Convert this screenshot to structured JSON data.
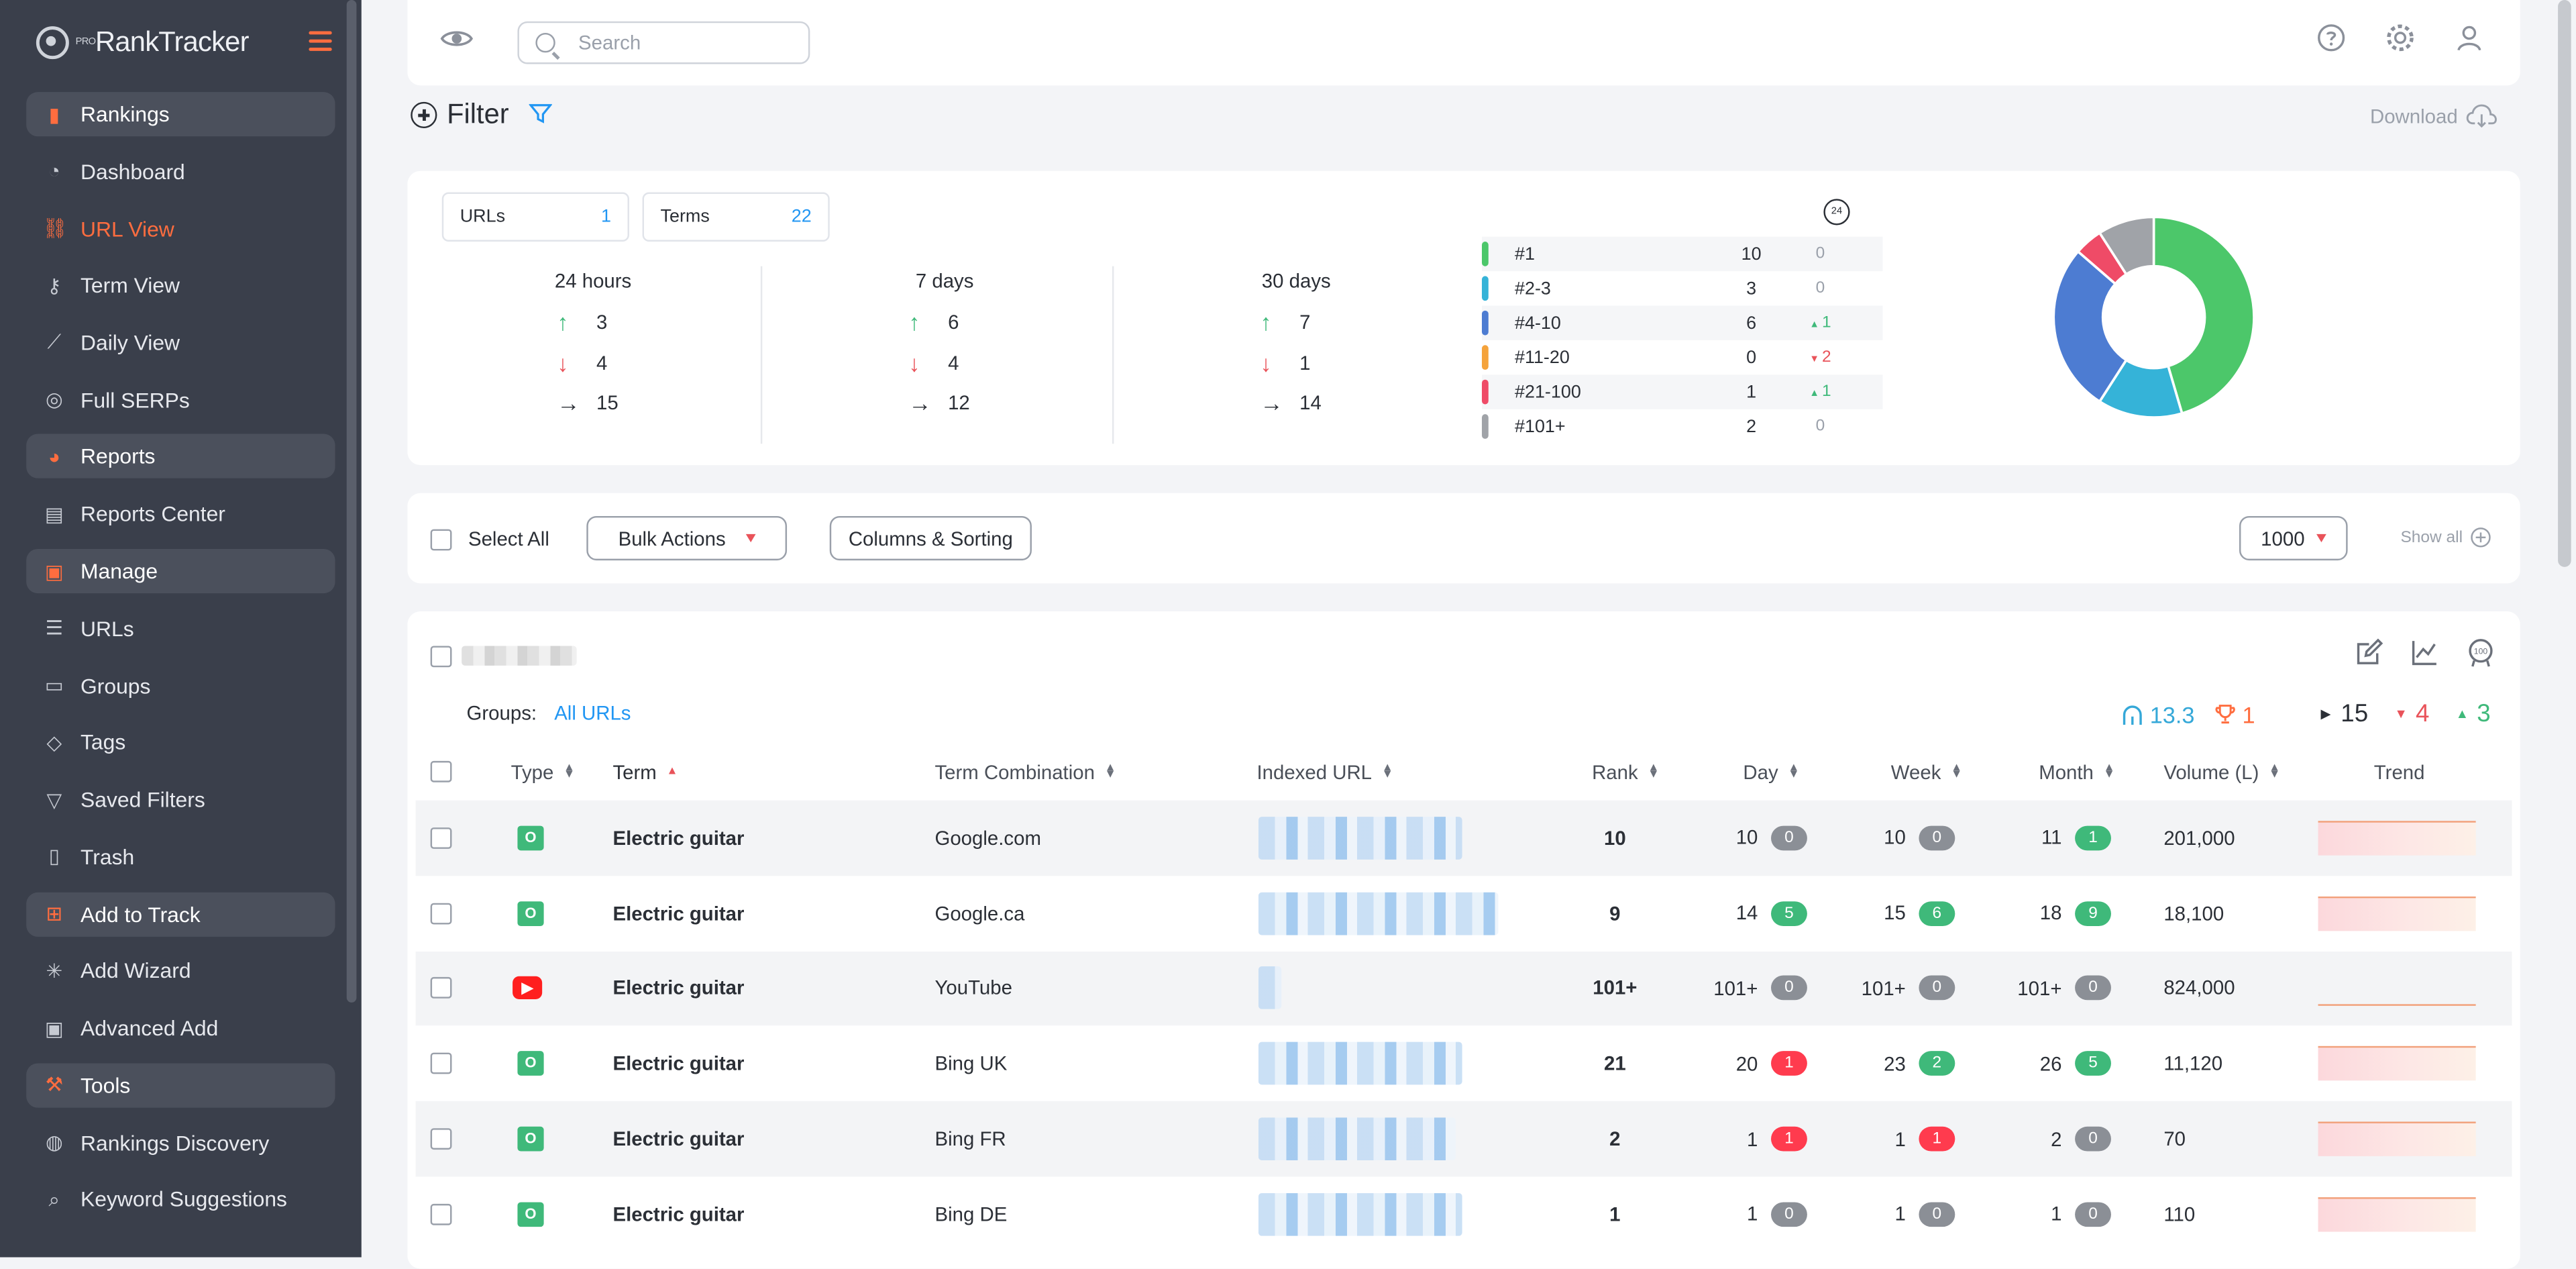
{
  "app": {
    "logo_text": "RankTracker",
    "logo_prefix": "PRO"
  },
  "sidebar": {
    "items": [
      {
        "label": "Rankings",
        "type": "section",
        "icon": "rankings-icon"
      },
      {
        "label": "Dashboard",
        "type": "item",
        "icon": "dashboard-icon"
      },
      {
        "label": "URL View",
        "type": "item",
        "icon": "link-icon",
        "active": true
      },
      {
        "label": "Term View",
        "type": "item",
        "icon": "key-icon"
      },
      {
        "label": "Daily View",
        "type": "item",
        "icon": "chart-icon"
      },
      {
        "label": "Full SERPs",
        "type": "item",
        "icon": "serp-icon"
      },
      {
        "label": "Reports",
        "type": "section",
        "icon": "pie-icon"
      },
      {
        "label": "Reports Center",
        "type": "item",
        "icon": "document-icon"
      },
      {
        "label": "Manage",
        "type": "section",
        "icon": "manage-icon"
      },
      {
        "label": "URLs",
        "type": "item",
        "icon": "list-icon"
      },
      {
        "label": "Groups",
        "type": "item",
        "icon": "folder-icon"
      },
      {
        "label": "Tags",
        "type": "item",
        "icon": "tag-icon"
      },
      {
        "label": "Saved Filters",
        "type": "item",
        "icon": "filter-icon"
      },
      {
        "label": "Trash",
        "type": "item",
        "icon": "trash-icon"
      },
      {
        "label": "Add to Track",
        "type": "section",
        "icon": "plus-square-icon"
      },
      {
        "label": "Add Wizard",
        "type": "item",
        "icon": "wizard-icon"
      },
      {
        "label": "Advanced Add",
        "type": "item",
        "icon": "clipboard-icon"
      },
      {
        "label": "Tools",
        "type": "section",
        "icon": "tools-icon"
      },
      {
        "label": "Rankings Discovery",
        "type": "item",
        "icon": "globe-icon"
      },
      {
        "label": "Keyword Suggestions",
        "type": "item",
        "icon": "search-icon"
      }
    ]
  },
  "topbar": {
    "search_placeholder": "Search"
  },
  "filter": {
    "title": "Filter",
    "download_label": "Download"
  },
  "summary": {
    "urls_label": "URLs",
    "urls_count": "1",
    "terms_label": "Terms",
    "terms_count": "22",
    "periods": [
      {
        "title": "24 hours",
        "up": "3",
        "down": "4",
        "flat": "15"
      },
      {
        "title": "7 days",
        "up": "6",
        "down": "4",
        "flat": "12"
      },
      {
        "title": "30 days",
        "up": "7",
        "down": "1",
        "flat": "14"
      }
    ],
    "clock_label": "24",
    "distribution": [
      {
        "label": "#1",
        "count": "10",
        "change": "0",
        "dir": "none",
        "color": "#4cc76a"
      },
      {
        "label": "#2-3",
        "count": "3",
        "change": "0",
        "dir": "none",
        "color": "#35b3d8"
      },
      {
        "label": "#4-10",
        "count": "6",
        "change": "1",
        "dir": "up",
        "color": "#4d7cd2"
      },
      {
        "label": "#11-20",
        "count": "0",
        "change": "2",
        "dir": "down",
        "color": "#f5a33b"
      },
      {
        "label": "#21-100",
        "count": "1",
        "change": "1",
        "dir": "up",
        "color": "#ef4b67"
      },
      {
        "label": "#101+",
        "count": "2",
        "change": "0",
        "dir": "none",
        "color": "#a0a3a8"
      }
    ],
    "donut_colors": [
      "#4cc76a",
      "#4fb3e6",
      "#4d7cd2",
      "#ef4b67",
      "#a0a3a8"
    ]
  },
  "bulk": {
    "select_all": "Select All",
    "bulk_actions": "Bulk Actions",
    "columns_sorting": "Columns & Sorting",
    "page_size": "1000",
    "show_all": "Show all"
  },
  "table": {
    "groups_label": "Groups:",
    "groups_value": "All URLs",
    "stats": {
      "avg": "13.3",
      "top": "1",
      "flat": "15",
      "down": "4",
      "up": "3"
    },
    "headers": {
      "type": "Type",
      "term": "Term",
      "combo": "Term Combination",
      "url": "Indexed URL",
      "rank": "Rank",
      "day": "Day",
      "week": "Week",
      "month": "Month",
      "volume": "Volume (L)",
      "trend": "Trend"
    },
    "rows": [
      {
        "type": "g",
        "term": "Electric guitar",
        "combo": "Google.com",
        "rank": "10",
        "day": "10",
        "day_chg": "0",
        "day_dir": "z",
        "week": "10",
        "week_chg": "0",
        "week_dir": "z",
        "month": "11",
        "month_chg": "1",
        "month_dir": "p",
        "volume": "201,000",
        "url_w": 124
      },
      {
        "type": "g",
        "term": "Electric guitar",
        "combo": "Google.ca",
        "rank": "9",
        "day": "14",
        "day_chg": "5",
        "day_dir": "p",
        "week": "15",
        "week_chg": "6",
        "week_dir": "p",
        "month": "18",
        "month_chg": "9",
        "month_dir": "p",
        "volume": "18,100",
        "url_w": 146
      },
      {
        "type": "yt",
        "term": "Electric guitar",
        "combo": "YouTube",
        "rank": "101+",
        "day": "101+",
        "day_chg": "0",
        "day_dir": "z",
        "week": "101+",
        "week_chg": "0",
        "week_dir": "z",
        "month": "101+",
        "month_chg": "0",
        "month_dir": "z",
        "volume": "824,000",
        "url_w": 14
      },
      {
        "type": "g",
        "term": "Electric guitar",
        "combo": "Bing UK",
        "rank": "21",
        "day": "20",
        "day_chg": "1",
        "day_dir": "n",
        "week": "23",
        "week_chg": "2",
        "week_dir": "p",
        "month": "26",
        "month_chg": "5",
        "month_dir": "p",
        "volume": "11,120",
        "url_w": 124
      },
      {
        "type": "g",
        "term": "Electric guitar",
        "combo": "Bing FR",
        "rank": "2",
        "day": "1",
        "day_chg": "1",
        "day_dir": "n",
        "week": "1",
        "week_chg": "1",
        "week_dir": "n",
        "month": "2",
        "month_chg": "0",
        "month_dir": "z",
        "volume": "70",
        "url_w": 120
      },
      {
        "type": "g",
        "term": "Electric guitar",
        "combo": "Bing DE",
        "rank": "1",
        "day": "1",
        "day_chg": "0",
        "day_dir": "z",
        "week": "1",
        "week_chg": "0",
        "week_dir": "z",
        "month": "1",
        "month_chg": "0",
        "month_dir": "z",
        "volume": "110",
        "url_w": 124
      }
    ]
  }
}
